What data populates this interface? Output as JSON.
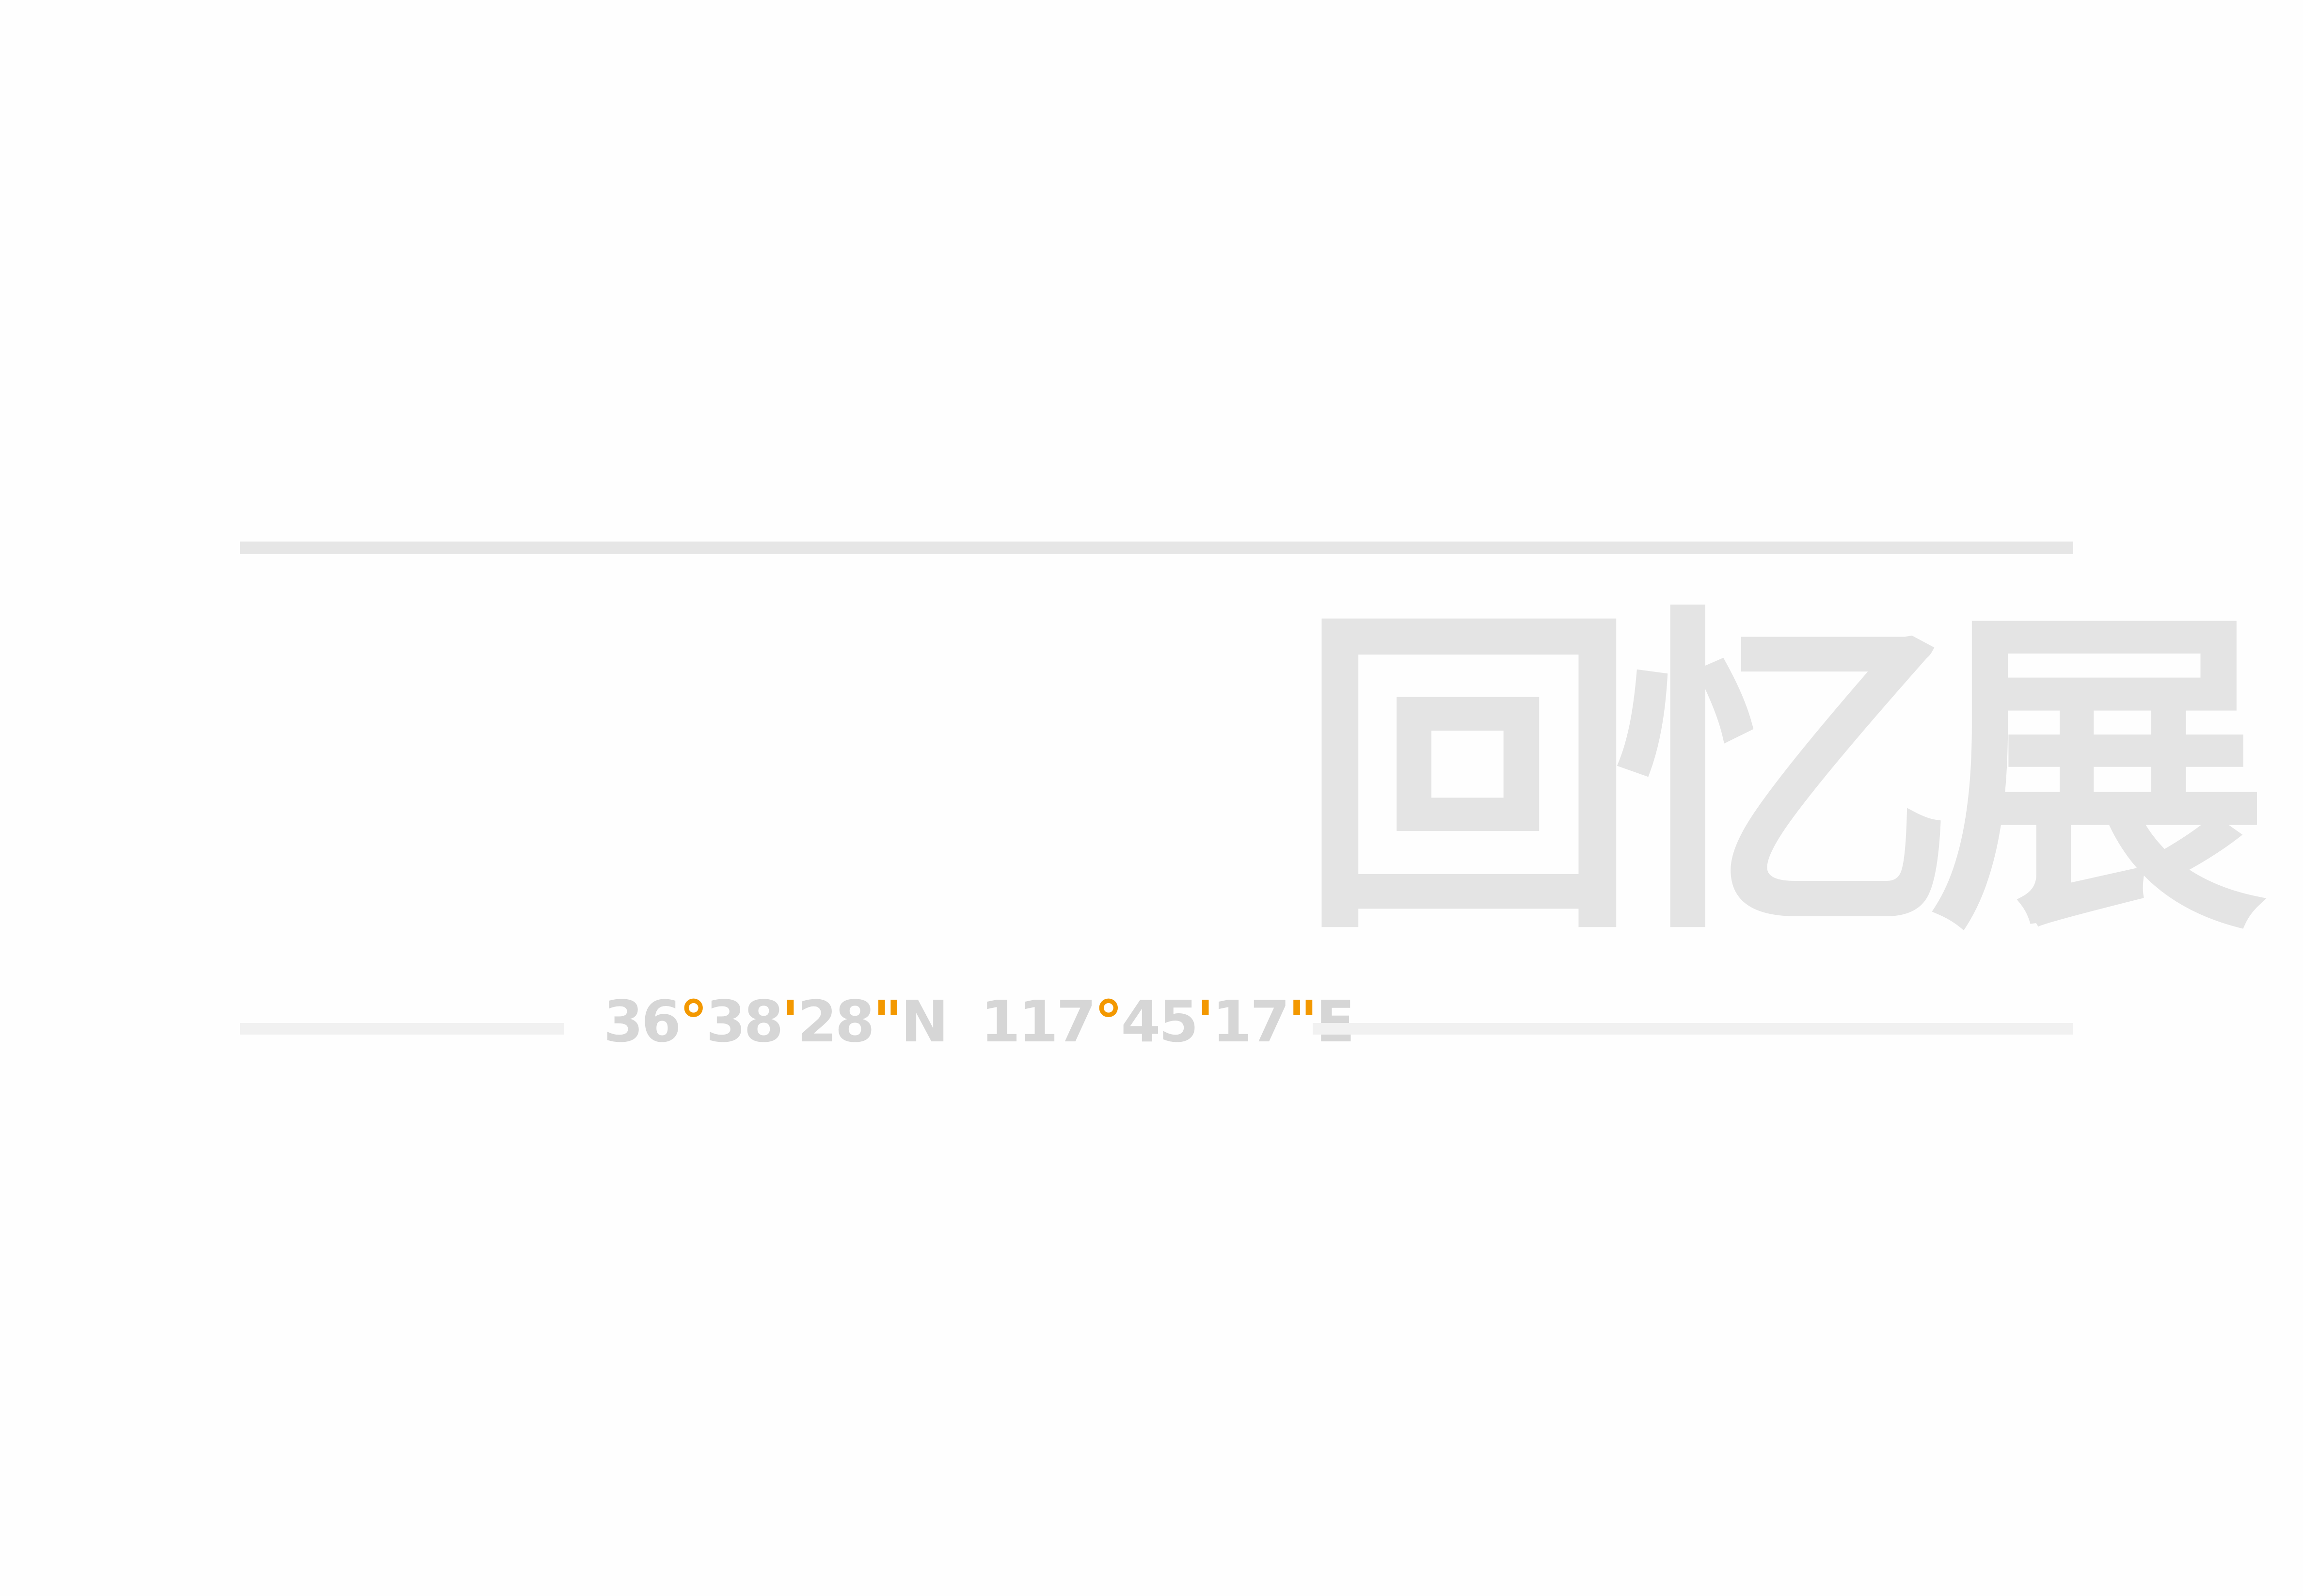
{
  "title": "回忆展",
  "coordinates": {
    "latitude": {
      "degrees": "36",
      "degree_mark": "°",
      "minutes": "38",
      "minute_mark": "'",
      "seconds": "28",
      "second_mark": "\"",
      "hemisphere": "N"
    },
    "longitude": {
      "degrees": "117",
      "degree_mark": "°",
      "minutes": "45",
      "minute_mark": "'",
      "seconds": "17",
      "second_mark": "\"",
      "hemisphere": "E"
    }
  },
  "colors": {
    "background": "#fefefe",
    "title": "#e4e4e4",
    "rule": "#e6e6e6",
    "coordinate_text": "#d6d6d6",
    "accent": "#f39800"
  }
}
